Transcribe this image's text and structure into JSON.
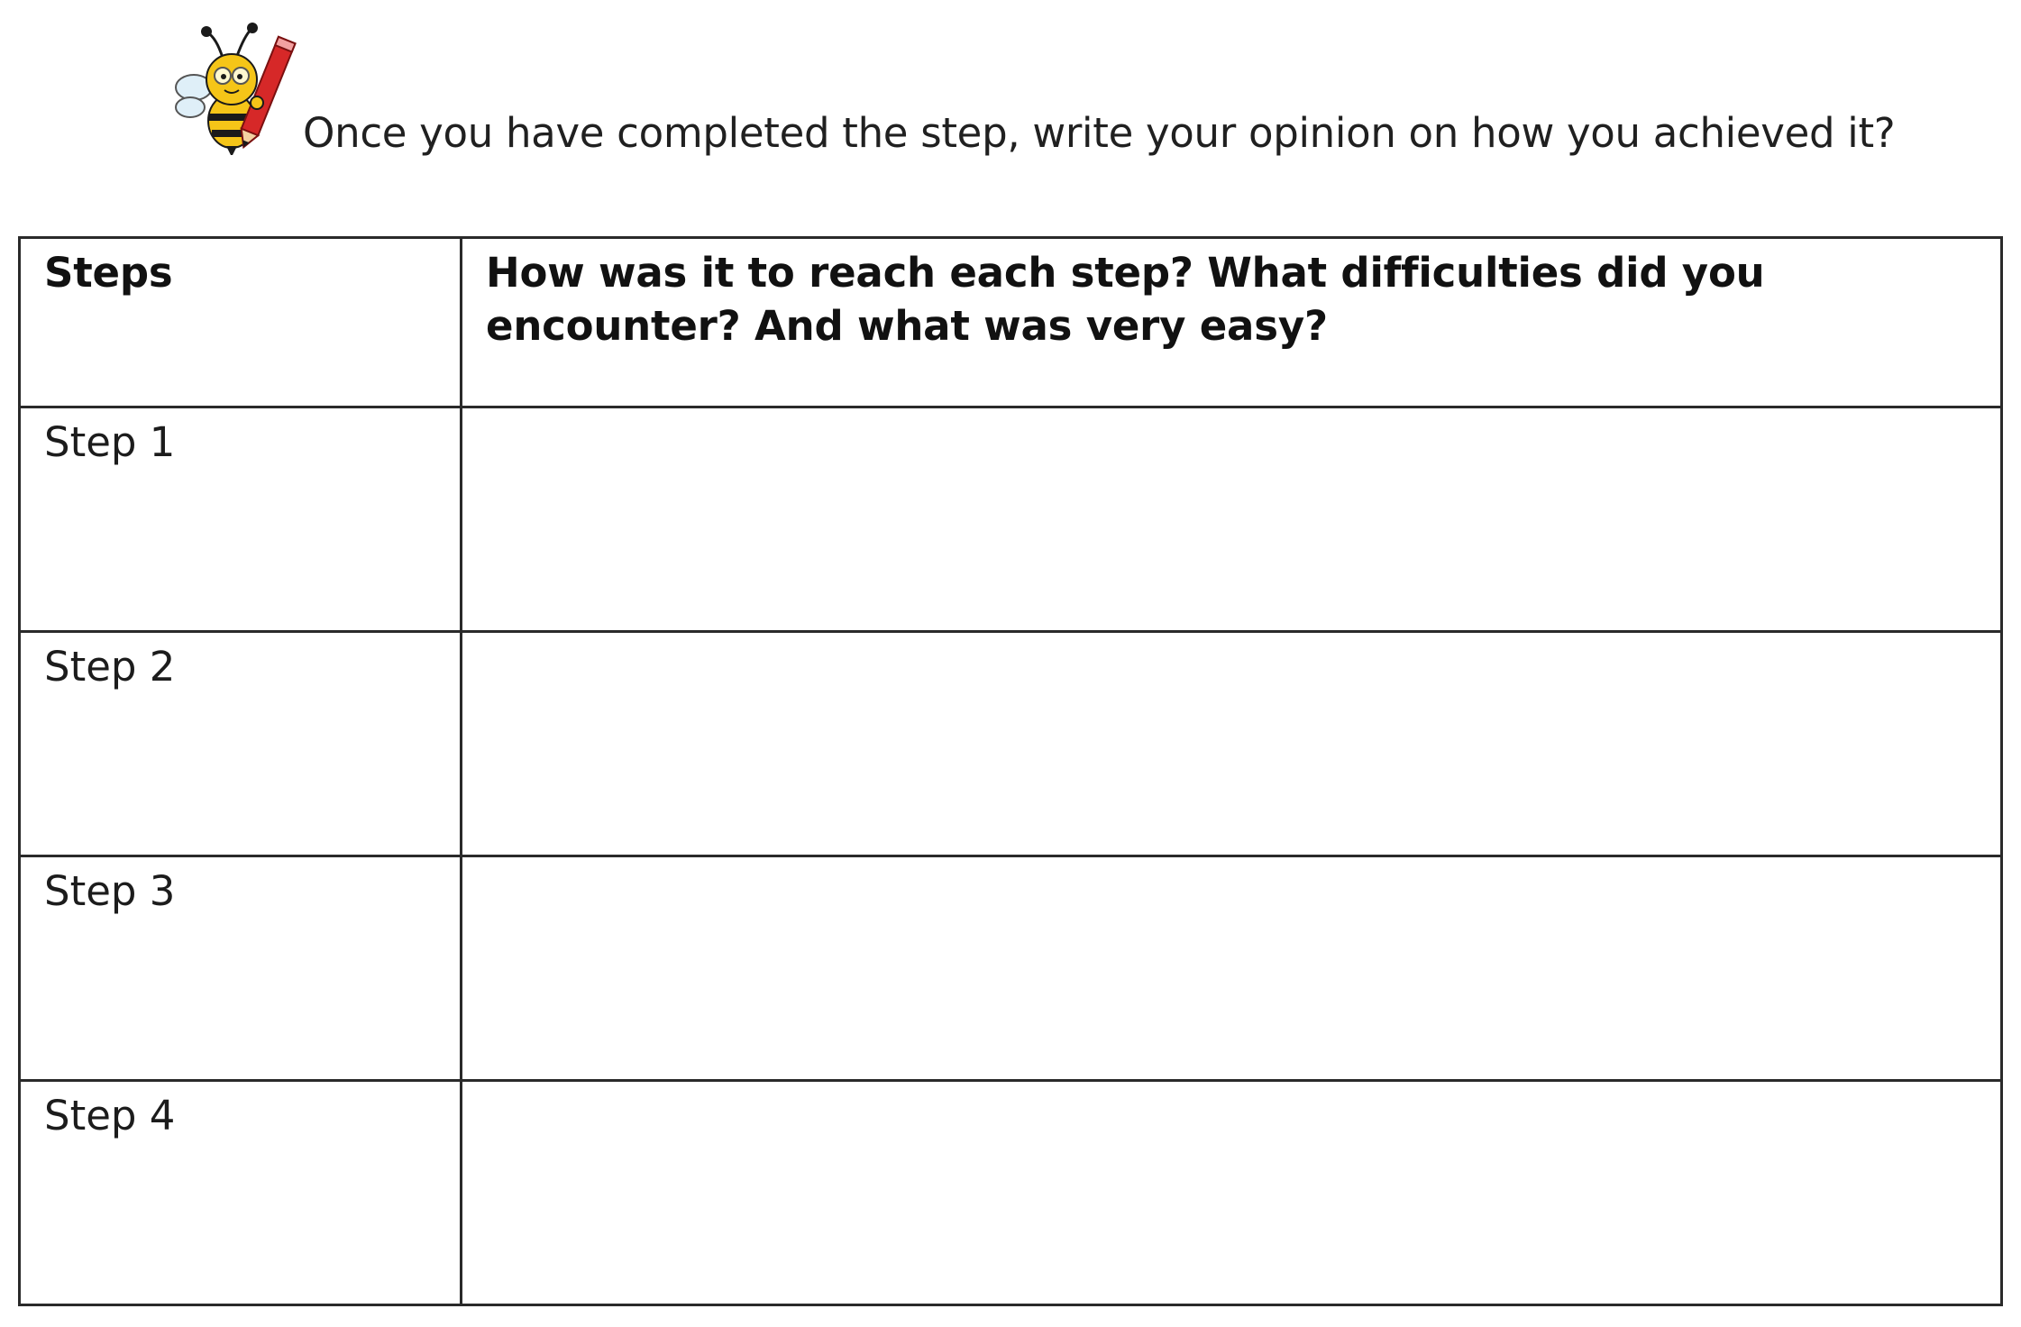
{
  "worksheet": {
    "instruction": "Once you have completed the step, write your opinion on how you achieved it?",
    "table": {
      "headers": {
        "steps": "Steps",
        "question": "How was it to reach each step? What difficulties did you encounter? And what was very easy?"
      },
      "rows": [
        {
          "label": "Step 1",
          "answer": ""
        },
        {
          "label": "Step 2",
          "answer": ""
        },
        {
          "label": "Step 3",
          "answer": ""
        },
        {
          "label": "Step 4",
          "answer": ""
        }
      ]
    }
  },
  "colors": {
    "border": "#2a2a2a",
    "bee_yellow": "#f5c518",
    "bee_black": "#1a1a1a",
    "pencil_red": "#d62828"
  }
}
